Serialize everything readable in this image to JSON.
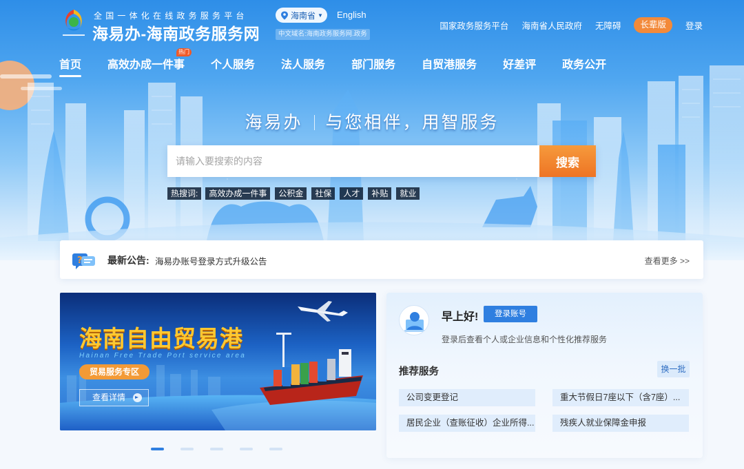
{
  "header": {
    "slogan": "全国一体化在线政务服务平台",
    "site_title": "海易办-海南政务服务网",
    "region": "海南省",
    "english_link": "English",
    "domain_note": "中文域名:海南政务服务网.政务",
    "links": [
      "国家政务服务平台",
      "海南省人民政府",
      "无障碍"
    ],
    "elder_mode": "长辈版",
    "login": "登录"
  },
  "nav": {
    "items": [
      "首页",
      "高效办成一件事",
      "个人服务",
      "法人服务",
      "部门服务",
      "自贸港服务",
      "好差评",
      "政务公开"
    ],
    "hot_badge": "热门"
  },
  "hero": {
    "slogan_left": "海易办",
    "slogan_right": "与您相伴，用智服务"
  },
  "search": {
    "placeholder": "请输入要搜索的内容",
    "button": "搜索",
    "hot_label": "热搜词:",
    "hot_terms": [
      "高效办成一件事",
      "公积金",
      "社保",
      "人才",
      "补贴",
      "就业"
    ]
  },
  "notice": {
    "label": "最新公告:",
    "text": "海易办账号登录方式升级公告",
    "more": "查看更多 >>"
  },
  "banner": {
    "title": "海南自由贸易港",
    "subtitle": "Hainan Free Trade Port service area",
    "tag": "贸易服务专区",
    "detail_button": "查看详情",
    "slides": 5,
    "active_slide": 1
  },
  "user_panel": {
    "greeting": "早上好!",
    "login_button": "登录账号",
    "hint": "登录后查看个人或企业信息和个性化推荐服务",
    "recommend_title": "推荐服务",
    "refresh_button": "换一批",
    "services": [
      "公司变更登记",
      "重大节假日7座以下（含7座）...",
      "居民企业（查账征收）企业所得...",
      "残疾人就业保障金申报"
    ]
  },
  "colors": {
    "primary_blue": "#2f7fe0",
    "accent_orange": "#ee7424",
    "banner_gold": "#ffc830"
  },
  "icons": [
    "location-pin-icon",
    "caret-down-icon",
    "notice-icon",
    "user-avatar-icon",
    "arrow-right-icon"
  ]
}
